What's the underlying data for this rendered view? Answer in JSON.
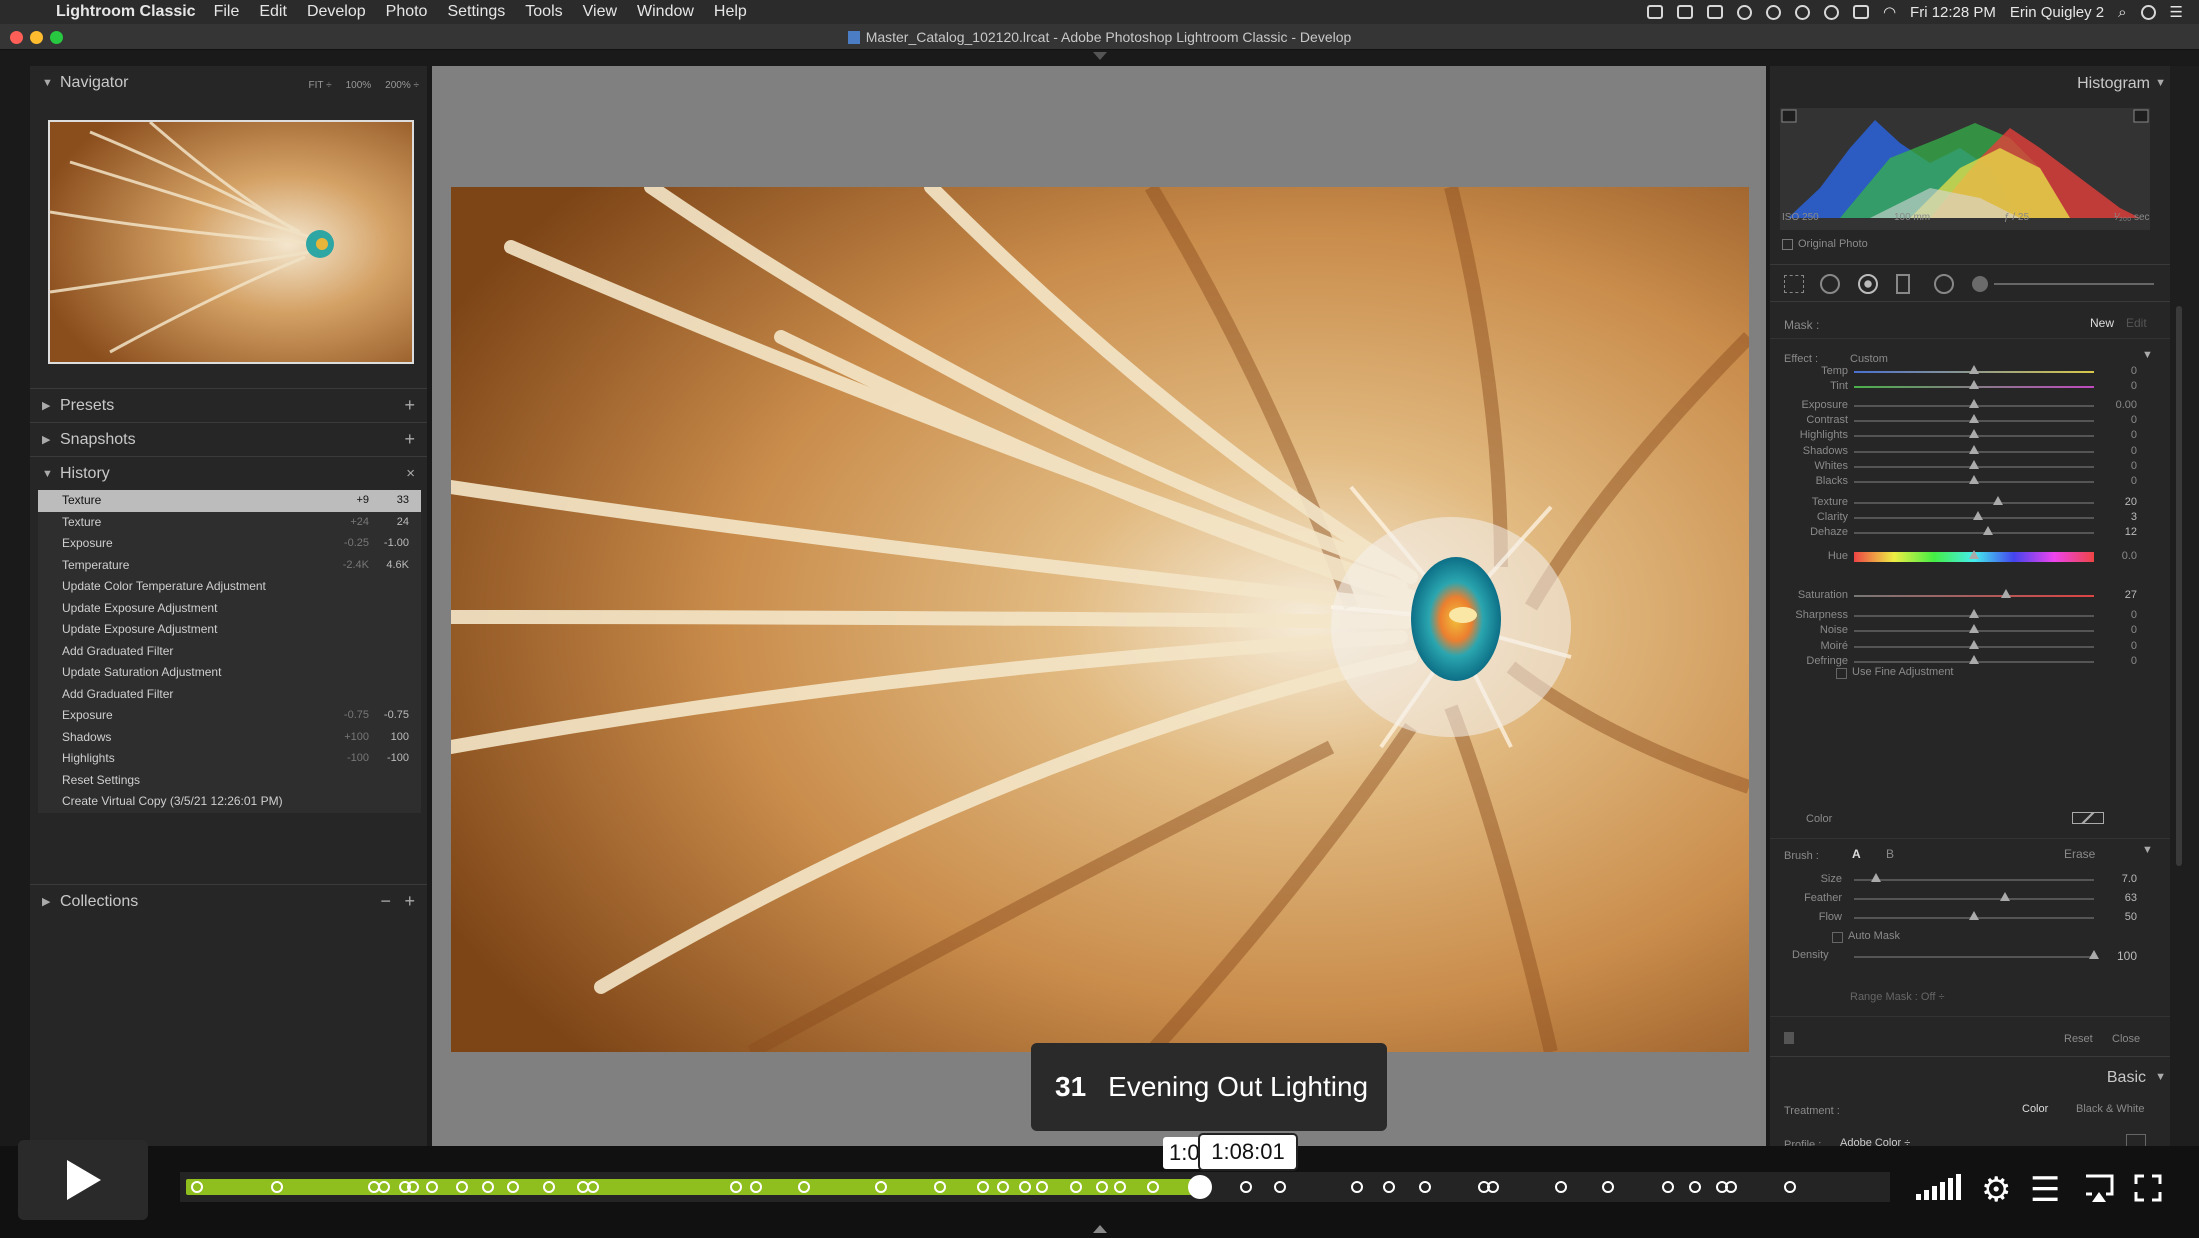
{
  "menubar": {
    "app_name": "Lightroom Classic",
    "items": [
      "File",
      "Edit",
      "Develop",
      "Photo",
      "Settings",
      "Tools",
      "View",
      "Window",
      "Help"
    ],
    "clock": "Fri 12:28 PM",
    "user": "Erin Quigley 2"
  },
  "window_title": "Master_Catalog_102120.lrcat - Adobe Photoshop Lightroom Classic - Develop",
  "left": {
    "navigator": {
      "title": "Navigator",
      "options": [
        "FIT ÷",
        "100%",
        "200% ÷"
      ]
    },
    "presets": "Presets",
    "snapshots": "Snapshots",
    "history": {
      "title": "History",
      "items": [
        {
          "label": "Texture",
          "a": "+9",
          "b": "33"
        },
        {
          "label": "Texture",
          "a": "+24",
          "b": "24"
        },
        {
          "label": "Exposure",
          "a": "-0.25",
          "b": "-1.00"
        },
        {
          "label": "Temperature",
          "a": "-2.4K",
          "b": "4.6K"
        },
        {
          "label": "Update Color Temperature Adjustment",
          "a": "",
          "b": ""
        },
        {
          "label": "Update Exposure Adjustment",
          "a": "",
          "b": ""
        },
        {
          "label": "Update Exposure Adjustment",
          "a": "",
          "b": ""
        },
        {
          "label": "Add Graduated Filter",
          "a": "",
          "b": ""
        },
        {
          "label": "Update Saturation Adjustment",
          "a": "",
          "b": ""
        },
        {
          "label": "Add Graduated Filter",
          "a": "",
          "b": ""
        },
        {
          "label": "Exposure",
          "a": "-0.75",
          "b": "-0.75"
        },
        {
          "label": "Shadows",
          "a": "+100",
          "b": "100"
        },
        {
          "label": "Highlights",
          "a": "-100",
          "b": "-100"
        },
        {
          "label": "Reset Settings",
          "a": "",
          "b": ""
        },
        {
          "label": "Create Virtual Copy (3/5/21 12:26:01 PM)",
          "a": "",
          "b": ""
        }
      ]
    },
    "collections": "Collections"
  },
  "right": {
    "histogram_title": "Histogram",
    "camera_info": {
      "iso": "ISO 250",
      "focal": "100 mm",
      "aperture": "ƒ / 25",
      "shutter": "¹⁄₂₀₀ sec"
    },
    "original_photo": "Original Photo",
    "mask_label": "Mask :",
    "mask_new": "New",
    "mask_edit": "Edit",
    "effect_label": "Effect :",
    "effect_value": "Custom",
    "sliders": [
      {
        "label": "Temp",
        "value": "0",
        "pos": 0.5
      },
      {
        "label": "Tint",
        "value": "0",
        "pos": 0.5
      },
      {
        "label": "Exposure",
        "value": "0.00",
        "pos": 0.5
      },
      {
        "label": "Contrast",
        "value": "0",
        "pos": 0.5
      },
      {
        "label": "Highlights",
        "value": "0",
        "pos": 0.5
      },
      {
        "label": "Shadows",
        "value": "0",
        "pos": 0.5
      },
      {
        "label": "Whites",
        "value": "0",
        "pos": 0.5
      },
      {
        "label": "Blacks",
        "value": "0",
        "pos": 0.5
      },
      {
        "label": "Texture",
        "value": "20",
        "pos": 0.6
      },
      {
        "label": "Clarity",
        "value": "3",
        "pos": 0.515
      },
      {
        "label": "Dehaze",
        "value": "12",
        "pos": 0.56
      },
      {
        "label": "Hue",
        "value": "0.0",
        "pos": 0.5
      },
      {
        "label": "Saturation",
        "value": "27",
        "pos": 0.635
      },
      {
        "label": "Sharpness",
        "value": "0",
        "pos": 0.5
      },
      {
        "label": "Noise",
        "value": "0",
        "pos": 0.5
      },
      {
        "label": "Moiré",
        "value": "0",
        "pos": 0.5
      },
      {
        "label": "Defringe",
        "value": "0",
        "pos": 0.5
      }
    ],
    "use_fine_adjustment": "Use Fine Adjustment",
    "color_label": "Color",
    "brush_label": "Brush :",
    "brush_a": "A",
    "brush_b": "B",
    "brush_erase": "Erase",
    "brush_sliders": [
      {
        "label": "Size",
        "value": "7.0",
        "pos": 0.09
      },
      {
        "label": "Feather",
        "value": "63",
        "pos": 0.63
      },
      {
        "label": "Flow",
        "value": "50",
        "pos": 0.5
      }
    ],
    "auto_mask": "Auto Mask",
    "density": {
      "label": "Density",
      "value": "100",
      "pos": 1.0
    },
    "range_mask": "Range Mask : Off ÷",
    "reset": "Reset",
    "close": "Close",
    "basic_title": "Basic",
    "treatment_label": "Treatment :",
    "treatment_color": "Color",
    "treatment_bw": "Black & White",
    "profile_label": "Profile :",
    "profile_value": "Adobe Color ÷"
  },
  "video": {
    "chapter_number": "31",
    "chapter_title": "Evening Out Lighting",
    "time_partial": "1:0",
    "time_tooltip": "1:08:01",
    "progress": 0.6
  }
}
